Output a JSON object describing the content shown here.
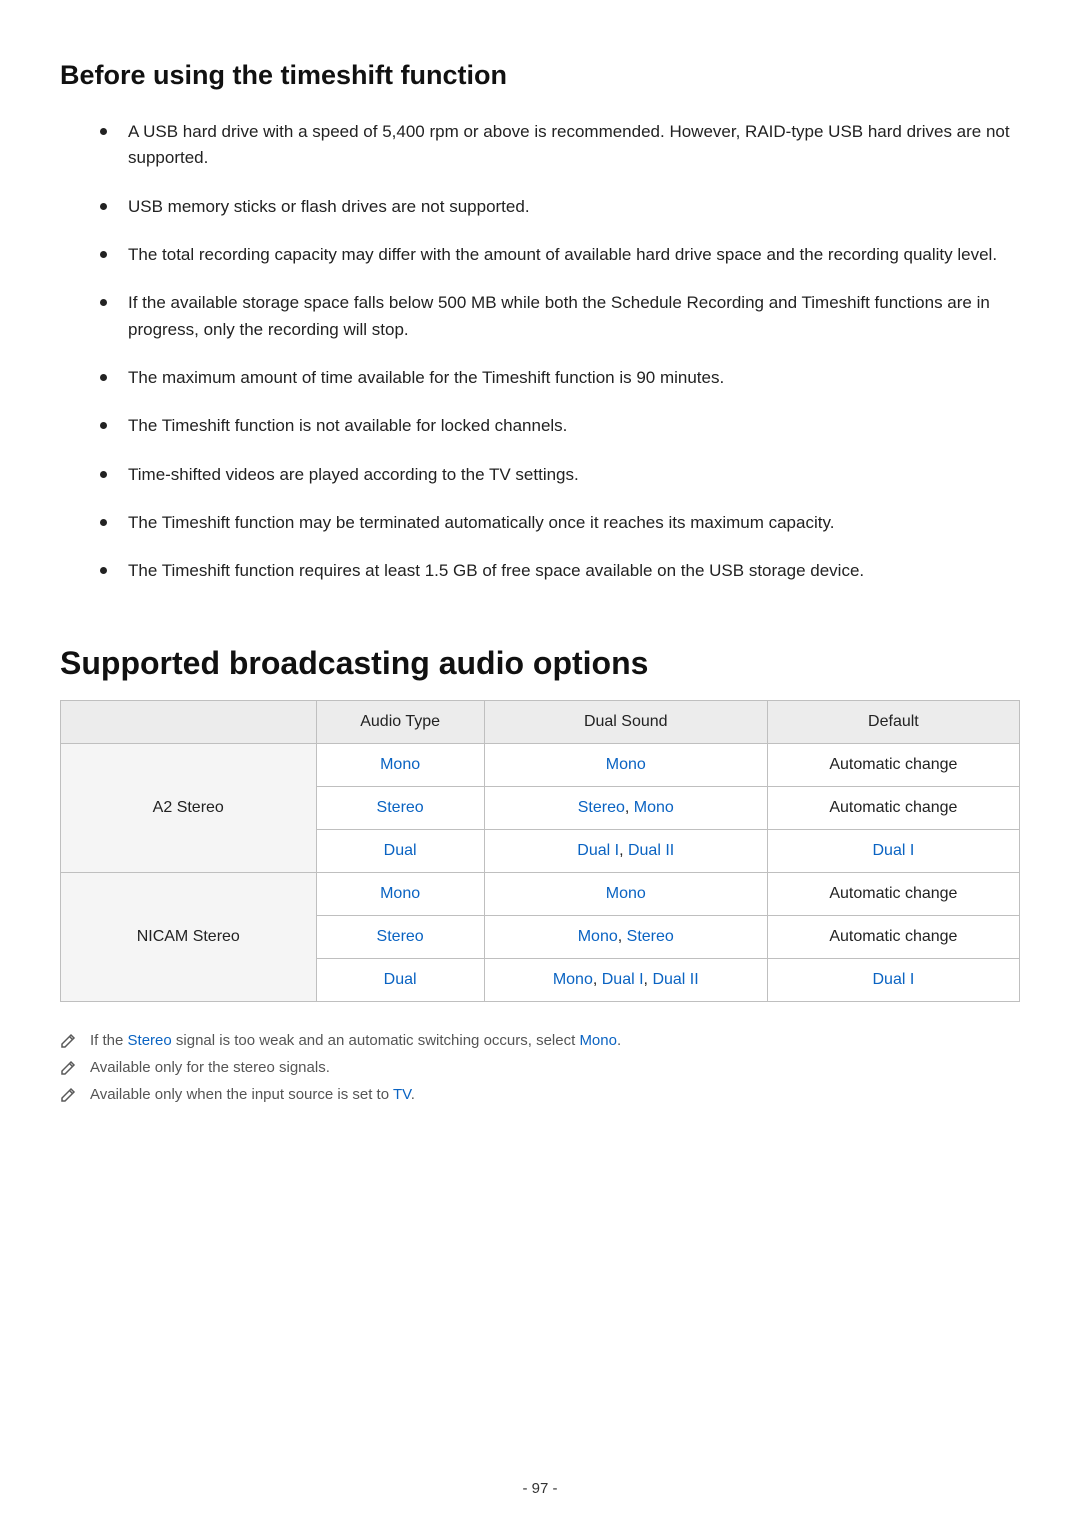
{
  "section1": {
    "title": "Before using the timeshift function",
    "bullets": [
      "A USB hard drive with a speed of 5,400 rpm or above is recommended. However, RAID-type USB hard drives are not supported.",
      "USB memory sticks or flash drives are not supported.",
      "The total recording capacity may differ with the amount of available hard drive space and the recording quality level.",
      "If the available storage space falls below 500 MB while both the Schedule Recording and Timeshift functions are in progress, only the recording will stop.",
      "The maximum amount of time available for the Timeshift function is 90 minutes.",
      "The Timeshift function is not available for locked channels.",
      "Time-shifted videos are played according to the TV settings.",
      "The Timeshift function may be terminated automatically once it reaches its maximum capacity.",
      "The Timeshift function requires at least 1.5 GB of free space available on the USB storage device."
    ]
  },
  "section2": {
    "title": "Supported broadcasting audio options",
    "columns": [
      "Audio Type",
      "Dual Sound",
      "Default"
    ],
    "groups": [
      {
        "label": "A2 Stereo",
        "rows": [
          {
            "audio_type": {
              "text": "Mono",
              "link": true
            },
            "dual_sound": [
              {
                "text": "Mono",
                "link": true
              }
            ],
            "default": {
              "text": "Automatic change",
              "link": false
            }
          },
          {
            "audio_type": {
              "text": "Stereo",
              "link": true
            },
            "dual_sound": [
              {
                "text": "Stereo",
                "link": true
              },
              {
                "text": ", ",
                "link": false
              },
              {
                "text": "Mono",
                "link": true
              }
            ],
            "default": {
              "text": "Automatic change",
              "link": false
            }
          },
          {
            "audio_type": {
              "text": "Dual",
              "link": true
            },
            "dual_sound": [
              {
                "text": "Dual I",
                "link": true
              },
              {
                "text": ", ",
                "link": false
              },
              {
                "text": "Dual II",
                "link": true
              }
            ],
            "default": {
              "text": "Dual I",
              "link": true
            }
          }
        ]
      },
      {
        "label": "NICAM Stereo",
        "rows": [
          {
            "audio_type": {
              "text": "Mono",
              "link": true
            },
            "dual_sound": [
              {
                "text": "Mono",
                "link": true
              }
            ],
            "default": {
              "text": "Automatic change",
              "link": false
            }
          },
          {
            "audio_type": {
              "text": "Stereo",
              "link": true
            },
            "dual_sound": [
              {
                "text": "Mono",
                "link": true
              },
              {
                "text": ", ",
                "link": false
              },
              {
                "text": "Stereo",
                "link": true
              }
            ],
            "default": {
              "text": "Automatic change",
              "link": false
            }
          },
          {
            "audio_type": {
              "text": "Dual",
              "link": true
            },
            "dual_sound": [
              {
                "text": "Mono",
                "link": true
              },
              {
                "text": ", ",
                "link": false
              },
              {
                "text": "Dual I",
                "link": true
              },
              {
                "text": ", ",
                "link": false
              },
              {
                "text": "Dual II",
                "link": true
              }
            ],
            "default": {
              "text": "Dual I",
              "link": true
            }
          }
        ]
      }
    ],
    "notes": [
      [
        {
          "text": "If the ",
          "link": false
        },
        {
          "text": "Stereo",
          "link": true
        },
        {
          "text": " signal is too weak and an automatic switching occurs, select ",
          "link": false
        },
        {
          "text": "Mono",
          "link": true
        },
        {
          "text": ".",
          "link": false
        }
      ],
      [
        {
          "text": "Available only for the stereo signals.",
          "link": false
        }
      ],
      [
        {
          "text": "Available only when the input source is set to ",
          "link": false
        },
        {
          "text": "TV",
          "link": true
        },
        {
          "text": ".",
          "link": false
        }
      ]
    ]
  },
  "page_number": "- 97 -"
}
